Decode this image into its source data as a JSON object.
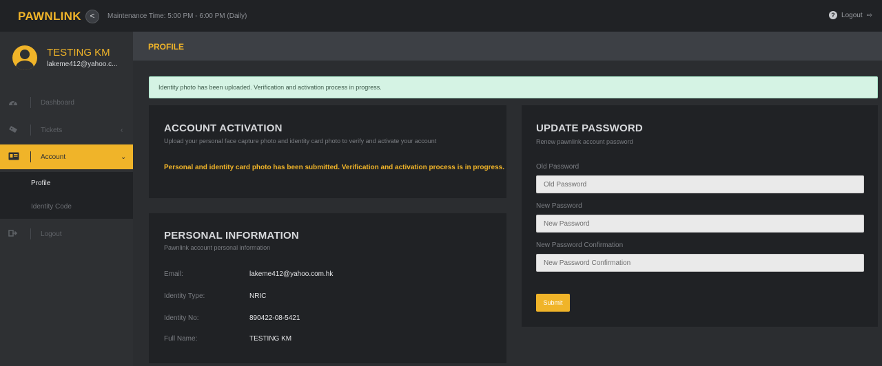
{
  "topbar": {
    "brand": "PAWNLINK",
    "back_icon": "<",
    "maintenance": "Maintenance Time: 5:00 PM - 6:00 PM (Daily)",
    "help_icon": "?",
    "logout_label": "Logout",
    "logout_icon": "⇨"
  },
  "user": {
    "name": "TESTING KM",
    "email": "lakeme412@yahoo.c..."
  },
  "nav": {
    "dashboard": {
      "label": "Dashboard",
      "icon": "dashboard-icon"
    },
    "tickets": {
      "label": "Tickets",
      "caret": "‹",
      "icon": "ticket-icon"
    },
    "account": {
      "label": "Account",
      "caret": "⌄",
      "icon": "id-card-icon"
    },
    "account_sub": {
      "profile": "Profile",
      "identity_code": "Identity Code"
    },
    "logout": {
      "label": "Logout",
      "icon": "logout-icon"
    }
  },
  "content": {
    "title": "PROFILE"
  },
  "alert": {
    "message": "Identity photo has been uploaded. Verification and activation process in progress."
  },
  "activation": {
    "title": "ACCOUNT ACTIVATION",
    "subtitle": "Upload your personal face capture photo and identity card photo to verify and activate your account",
    "status": "Personal and identity card photo has been submitted. Verification and activation process is in progress."
  },
  "personal": {
    "title": "PERSONAL INFORMATION",
    "subtitle": "Pawnlink account personal information",
    "rows": [
      {
        "label": "Email:",
        "value": "lakeme412@yahoo.com.hk"
      },
      {
        "label": "Identity Type:",
        "value": "NRIC"
      },
      {
        "label": "Identity No:",
        "value": "890422-08-5421"
      },
      {
        "label": "Full Name:",
        "value": "TESTING KM"
      }
    ]
  },
  "password": {
    "title": "UPDATE PASSWORD",
    "subtitle": "Renew pawnlink account password",
    "old_label": "Old Password",
    "old_placeholder": "Old Password",
    "new_label": "New Password",
    "new_placeholder": "New Password",
    "confirm_label": "New Password Confirmation",
    "confirm_placeholder": "New Password Confirmation",
    "submit_label": "Submit"
  },
  "colors": {
    "accent": "#f0b429",
    "background": "#2b2d30",
    "panel": "#202225",
    "alert_bg": "#d5f3e4"
  }
}
